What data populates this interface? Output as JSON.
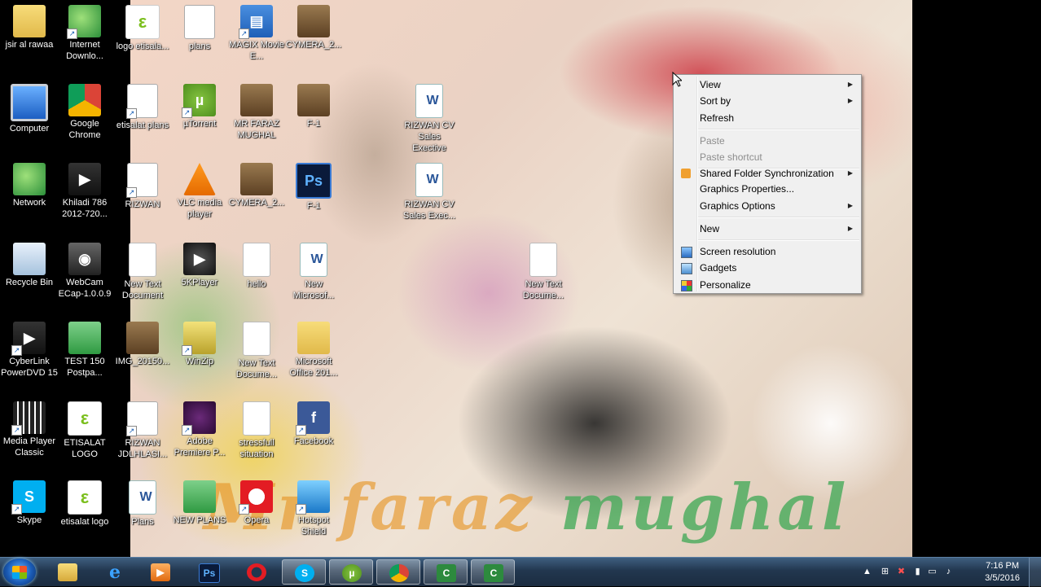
{
  "desktop": {
    "wallpaper_text": [
      "Mr",
      "faraz",
      "mughal"
    ],
    "icons": [
      {
        "label": "jsir al rawaa"
      },
      {
        "label": "Internet Downlo..."
      },
      {
        "label": "logo etisala..."
      },
      {
        "label": "plans"
      },
      {
        "label": "MAGIX Movie E..."
      },
      {
        "label": "CYMERA_2..."
      },
      {
        "label": "Computer"
      },
      {
        "label": "Google Chrome"
      },
      {
        "label": "etisalat plans"
      },
      {
        "label": "µTorrent"
      },
      {
        "label": "MR FARAZ MUGHAL"
      },
      {
        "label": "F-1"
      },
      {
        "label": "RIZWAN CV Sales Exective"
      },
      {
        "label": "Network"
      },
      {
        "label": "Khiladi 786 2012-720..."
      },
      {
        "label": "RIZWAN"
      },
      {
        "label": "VLC media player"
      },
      {
        "label": "CYMERA_2..."
      },
      {
        "label": "F-1"
      },
      {
        "label": "RIZWAN CV Sales Exec..."
      },
      {
        "label": "Recycle Bin"
      },
      {
        "label": "WebCam ECap-1.0.0.9"
      },
      {
        "label": "New Text Document"
      },
      {
        "label": "5KPlayer"
      },
      {
        "label": "hello"
      },
      {
        "label": "New Microsof..."
      },
      {
        "label": "New Text Docume..."
      },
      {
        "label": "CyberLink PowerDVD 15"
      },
      {
        "label": "TEST 150 Postpa..."
      },
      {
        "label": "IMG_20150..."
      },
      {
        "label": "WinZip"
      },
      {
        "label": "New Text Docume..."
      },
      {
        "label": "Microsoft Office 201..."
      },
      {
        "label": "Media Player Classic"
      },
      {
        "label": "ETISALAT LOGO"
      },
      {
        "label": "RIZWAN JDLHLASI..."
      },
      {
        "label": "Adobe Premiere P..."
      },
      {
        "label": "stressfull situation"
      },
      {
        "label": "Facebook"
      },
      {
        "label": "Skype"
      },
      {
        "label": "etisalat logo"
      },
      {
        "label": "Plans"
      },
      {
        "label": "NEW PLANS"
      },
      {
        "label": "Opera"
      },
      {
        "label": "Hotspot Shield"
      }
    ]
  },
  "context_menu": {
    "items": [
      {
        "label": "View",
        "submenu": true,
        "enabled": true
      },
      {
        "label": "Sort by",
        "submenu": true,
        "enabled": true
      },
      {
        "label": "Refresh",
        "submenu": false,
        "enabled": true
      },
      {
        "label": "Paste",
        "submenu": false,
        "enabled": false
      },
      {
        "label": "Paste shortcut",
        "submenu": false,
        "enabled": false
      },
      {
        "label": "Shared Folder Synchronization",
        "submenu": true,
        "enabled": true,
        "icon": "sync-folder-icon"
      },
      {
        "label": "Graphics Properties...",
        "submenu": false,
        "enabled": true
      },
      {
        "label": "Graphics Options",
        "submenu": true,
        "enabled": true
      },
      {
        "label": "New",
        "submenu": true,
        "enabled": true
      },
      {
        "label": "Screen resolution",
        "submenu": false,
        "enabled": true,
        "icon": "screen-resolution-icon"
      },
      {
        "label": "Gadgets",
        "submenu": false,
        "enabled": true,
        "icon": "gadgets-icon"
      },
      {
        "label": "Personalize",
        "submenu": false,
        "enabled": true,
        "icon": "personalize-icon"
      }
    ]
  },
  "taskbar": {
    "pinned": [
      {
        "name": "windows-explorer"
      },
      {
        "name": "internet-explorer"
      },
      {
        "name": "media-player"
      },
      {
        "name": "photoshop",
        "text": "Ps"
      },
      {
        "name": "opera"
      },
      {
        "name": "skype"
      },
      {
        "name": "utorrent"
      },
      {
        "name": "chrome"
      },
      {
        "name": "camtasia"
      },
      {
        "name": "camtasia-recorder"
      }
    ],
    "clock": {
      "time": "7:16 PM",
      "date": "3/5/2016"
    }
  }
}
